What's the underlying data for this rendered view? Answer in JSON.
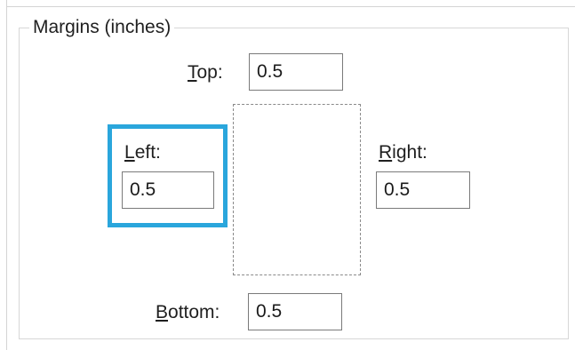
{
  "margins_group": {
    "legend": "Margins (inches)"
  },
  "top": {
    "label_access": "T",
    "label_rest": "op:",
    "value": "0.5"
  },
  "left": {
    "label_access": "L",
    "label_rest": "eft:",
    "value": "0.5",
    "focused": true
  },
  "right": {
    "label_access": "R",
    "label_rest": "ight:",
    "value": "0.5"
  },
  "bottom": {
    "label_access": "B",
    "label_rest": "ottom:",
    "value": "0.5"
  },
  "colors": {
    "focus_ring": "#2aa6dc",
    "group_border": "#d7d7d7",
    "input_border": "#7a7a7a"
  }
}
